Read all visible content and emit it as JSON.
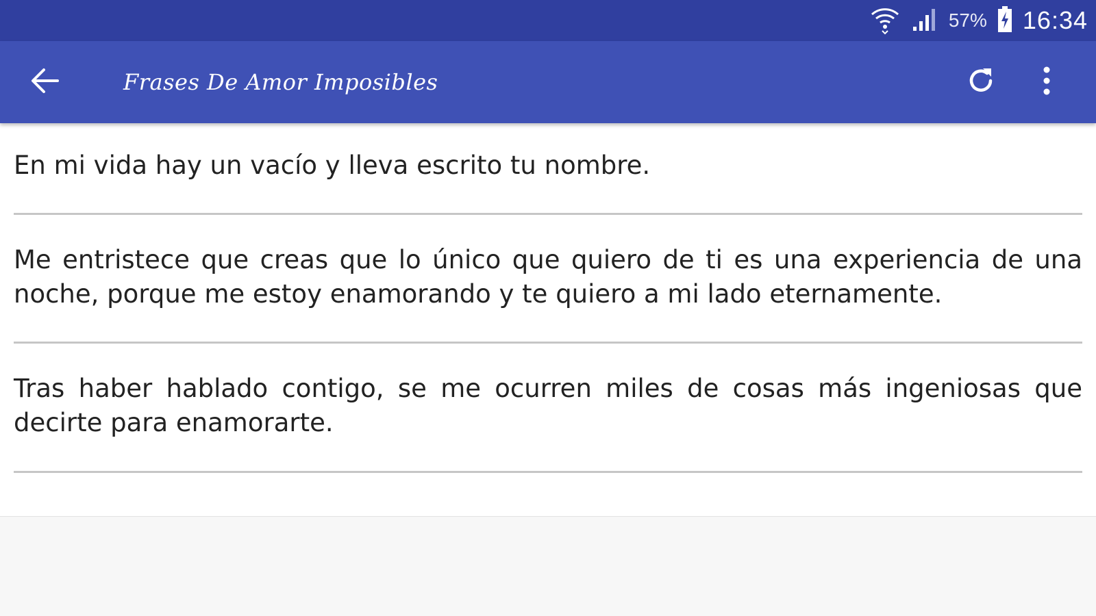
{
  "status_bar": {
    "battery": "57%",
    "time": "16:34",
    "icons": [
      "wifi-icon",
      "signal-icon",
      "battery-charging-icon"
    ]
  },
  "app_bar": {
    "title": "Frases De Amor Imposibles",
    "icons": [
      "back-arrow-icon",
      "refresh-icon",
      "more-vert-icon"
    ]
  },
  "phrases": [
    "En mi vida hay un vacío y lleva escrito tu nombre.",
    "Me entristece que creas que lo único que quiero de ti es una experiencia de una noche, porque me estoy enamorando y te quiero a mi lado eternamente.",
    "Tras haber hablado contigo, se me ocurren miles de cosas más ingeniosas que decirte para enamorarte."
  ],
  "colors": {
    "status_bar": "#303f9f",
    "app_bar": "#3f51b5",
    "content_bg": "#ffffff",
    "page_bg": "#f7f7f7",
    "divider": "#c6c6c6",
    "text": "#222222"
  }
}
